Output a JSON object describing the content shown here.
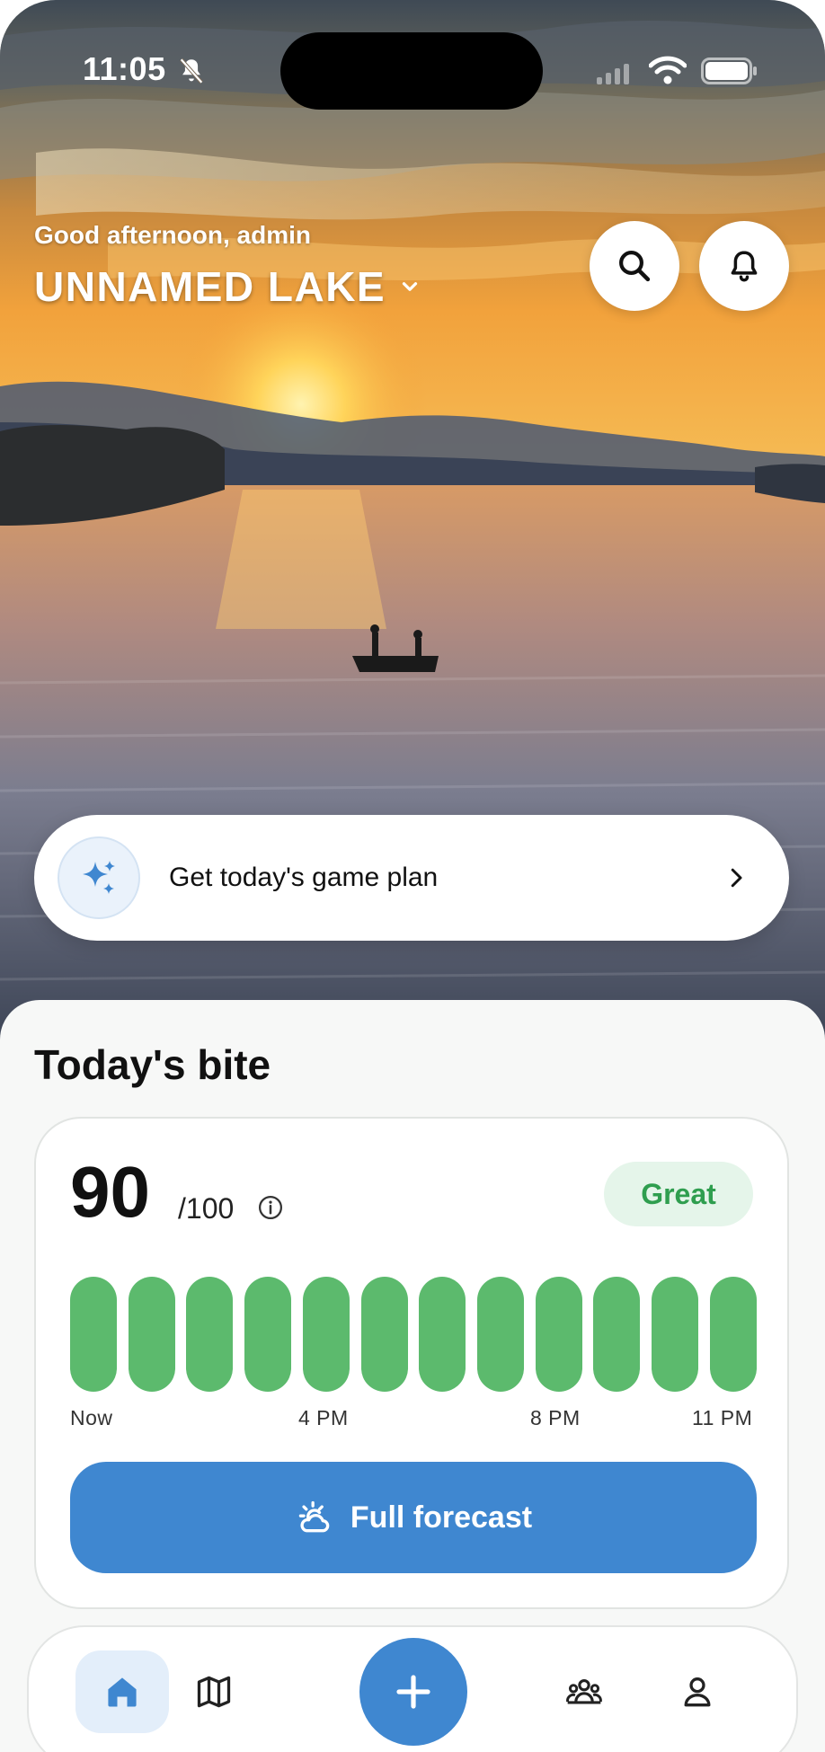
{
  "status_bar": {
    "time": "11:05",
    "icons": [
      "bell-slash-icon",
      "signal-icon",
      "wifi-icon",
      "battery-icon"
    ]
  },
  "header": {
    "greeting": "Good afternoon, admin",
    "lake_name": "UNNAMED LAKE",
    "lake_dropdown_icon": "chevron-down-icon",
    "search_icon": "search-icon",
    "notifications_icon": "bell-icon"
  },
  "game_plan": {
    "label": "Get today's game plan",
    "icon": "sparkle-icon",
    "chevron": "chevron-right-icon"
  },
  "bite": {
    "section_title": "Today's bite",
    "score": "90",
    "score_max": "/100",
    "info_icon": "info-icon",
    "rating": "Great",
    "hourly_bars": [
      1,
      1,
      1,
      1,
      1,
      1,
      1,
      1,
      1,
      1,
      1,
      1
    ],
    "time_labels": [
      "Now",
      "4 PM",
      "8 PM",
      "11 PM"
    ],
    "forecast_button": "Full forecast",
    "forecast_icon": "sun-cloud-icon"
  },
  "tab_bar": {
    "tabs": [
      {
        "name": "home",
        "icon": "home-icon",
        "active": true
      },
      {
        "name": "map",
        "icon": "map-icon",
        "active": false
      },
      {
        "name": "add",
        "icon": "plus-icon",
        "active": false
      },
      {
        "name": "community",
        "icon": "people-icon",
        "active": false
      },
      {
        "name": "profile",
        "icon": "person-icon",
        "active": false
      }
    ]
  },
  "colors": {
    "accent_blue": "#3f87d0",
    "bite_green": "#5cba6d",
    "rating_green_text": "#2f9e4f",
    "rating_green_bg": "#e5f5ea"
  }
}
